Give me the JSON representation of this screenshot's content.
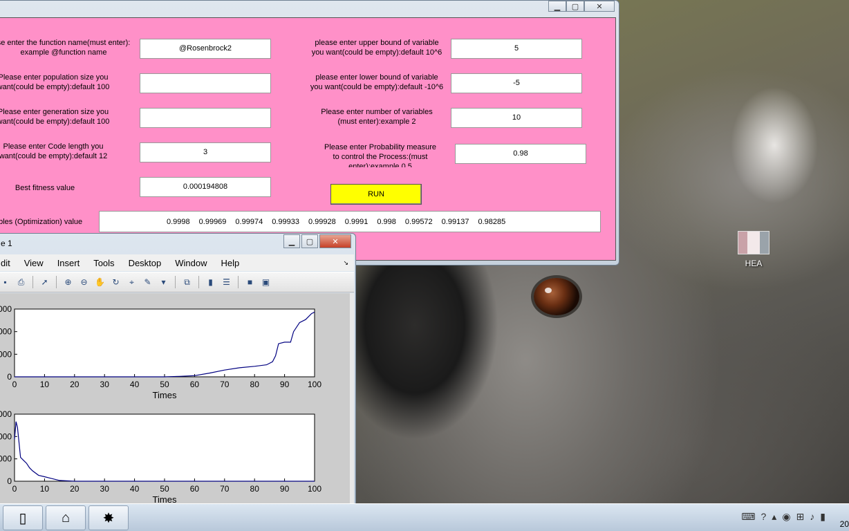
{
  "gui": {
    "labels": {
      "function_name_1": "se enter the function name(must enter):",
      "function_name_2": "example @function name",
      "population_1": "Please enter population size you",
      "population_2": "want(could be empty):default 100",
      "generation_1": "Please enter generation size you",
      "generation_2": "want(could be empty):default 100",
      "code_length_1": "Please enter Code length you",
      "code_length_2": "want(could be empty):default 12",
      "best_fitness": "Best fitness value",
      "upper_bound_1": "please enter upper bound of variable",
      "upper_bound_2": "you want(could be empty):default 10^6",
      "lower_bound_1": "please enter lower bound of variable",
      "lower_bound_2": "you want(could be empty):default -10^6",
      "num_vars_1": "Please enter number of variables",
      "num_vars_2": "(must enter):example 2",
      "probability_1": "Please enter Probability measure",
      "probability_2": "to control the Process:(must",
      "probability_3": "enter):example 0.5",
      "variables_value": "ables (Optimization) value"
    },
    "fields": {
      "function_name": "@Rosenbrock2",
      "population": "",
      "generation": "",
      "code_length": "3",
      "best_fitness": "0.000194808",
      "upper_bound": "5",
      "lower_bound": "-5",
      "num_vars": "10",
      "probability": "0.98"
    },
    "run_label": "RUN",
    "variables": [
      "0.9998",
      "0.99969",
      "0.99974",
      "0.99933",
      "0.99928",
      "0.9991",
      "0.998",
      "0.99572",
      "0.99137",
      "0.98285"
    ]
  },
  "figure": {
    "title": "e 1",
    "menu": [
      "dit",
      "View",
      "Insert",
      "Tools",
      "Desktop",
      "Window",
      "Help"
    ]
  },
  "chart_data": [
    {
      "type": "line",
      "xlabel": "Times",
      "ylabel": "",
      "xlim": [
        0,
        100
      ],
      "xticks": [
        "0",
        "10",
        "20",
        "30",
        "40",
        "50",
        "60",
        "70",
        "80",
        "90",
        "100"
      ],
      "yticks": [
        "0",
        "000",
        "000",
        "000"
      ],
      "x": [
        0,
        10,
        20,
        30,
        40,
        50,
        55,
        60,
        65,
        70,
        75,
        80,
        84,
        86,
        87,
        88,
        90,
        91,
        92,
        93,
        95,
        97,
        99,
        100
      ],
      "y": [
        0,
        0,
        0,
        0,
        0,
        0,
        0.3,
        0.8,
        2.5,
        4.5,
        6,
        7,
        8,
        10,
        14,
        22,
        23,
        23,
        23,
        30,
        36,
        38,
        42,
        43
      ],
      "ylim": [
        0,
        45
      ]
    },
    {
      "type": "line",
      "xlabel": "Times",
      "ylabel": "",
      "xlim": [
        0,
        100
      ],
      "xticks": [
        "0",
        "10",
        "20",
        "30",
        "40",
        "50",
        "60",
        "70",
        "80",
        "90",
        "100"
      ],
      "yticks": [
        "0",
        "000",
        "000",
        "000"
      ],
      "x": [
        0,
        0.5,
        1,
        2,
        3,
        4,
        5,
        6,
        8,
        10,
        12,
        15,
        20,
        30,
        40,
        60,
        80,
        100
      ],
      "y": [
        28,
        40,
        36,
        16,
        14,
        12,
        9,
        7,
        4,
        3,
        2,
        0.5,
        0,
        0,
        0,
        0,
        0,
        0
      ],
      "ylim": [
        0,
        45
      ]
    }
  ],
  "desktop_icon_label": "HEA",
  "taskbar": {
    "clock": "20"
  }
}
